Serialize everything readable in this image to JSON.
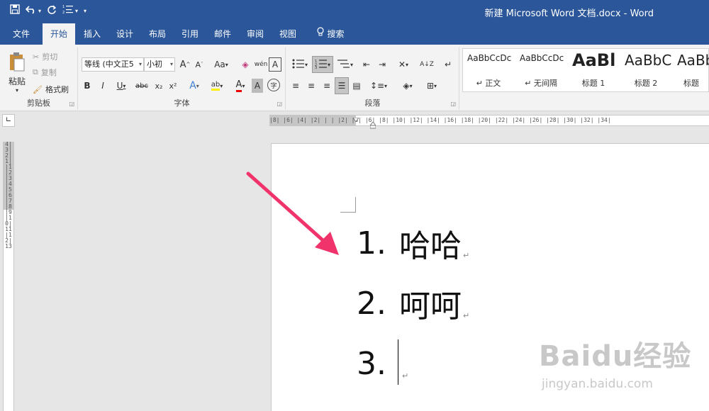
{
  "app": {
    "title": "新建 Microsoft Word 文档.docx  -  Word"
  },
  "quick_access": {
    "save_icon": "save-icon",
    "undo_icon": "undo-icon",
    "redo_icon": "redo-icon",
    "list_icon": "numbering-icon",
    "customize_icon": "chevron-down-icon"
  },
  "tabs": [
    {
      "label": "文件"
    },
    {
      "label": "开始",
      "active": true
    },
    {
      "label": "插入"
    },
    {
      "label": "设计"
    },
    {
      "label": "布局"
    },
    {
      "label": "引用"
    },
    {
      "label": "邮件"
    },
    {
      "label": "审阅"
    },
    {
      "label": "视图"
    },
    {
      "label": "搜索"
    }
  ],
  "ribbon": {
    "clipboard": {
      "label": "剪贴板",
      "paste": "粘贴",
      "cut": "剪切",
      "copy": "复制",
      "format_painter": "格式刷"
    },
    "font": {
      "label": "字体",
      "font_name": "等线 (中文正5",
      "font_size": "小初",
      "bold": "B",
      "italic": "I",
      "underline": "U",
      "strikethrough": "abc",
      "subscript": "x₂",
      "superscript": "x²",
      "grow": "A",
      "shrink": "A",
      "change_case": "Aa",
      "text_effects": "A",
      "highlight": "ab",
      "font_color": "A",
      "char_shading": "A",
      "enclose_char": "字"
    },
    "paragraph": {
      "label": "段落"
    },
    "styles": {
      "items": [
        {
          "sample": "AaBbCcDc",
          "name": "↵ 正文"
        },
        {
          "sample": "AaBbCcDc",
          "name": "↵ 无间隔"
        },
        {
          "sample": "AaBl",
          "name": "标题 1"
        },
        {
          "sample": "AaBbC",
          "name": "标题 2"
        },
        {
          "sample": "AaBb",
          "name": "标题"
        }
      ]
    }
  },
  "ruler": {
    "horizontal": "|8| |6| |4| |2| | | |2| |4| |6| |8| |10| |12| |14| |16| |18| |20| |22| |24| |26| |28| |30| |32| |34|",
    "vertical": "4|3|2|1| |1|2|3|4|5|6|7|8|9|10|11|12|13"
  },
  "document": {
    "list": [
      {
        "num": "1.",
        "text": "哈哈"
      },
      {
        "num": "2.",
        "text": "呵呵"
      },
      {
        "num": "3.",
        "text": ""
      }
    ],
    "para_mark": "↵"
  },
  "watermark": {
    "logo": "Baidu经验",
    "url": "jingyan.baidu.com"
  },
  "colors": {
    "accent": "#2b579a",
    "arrow": "#f0346b"
  }
}
